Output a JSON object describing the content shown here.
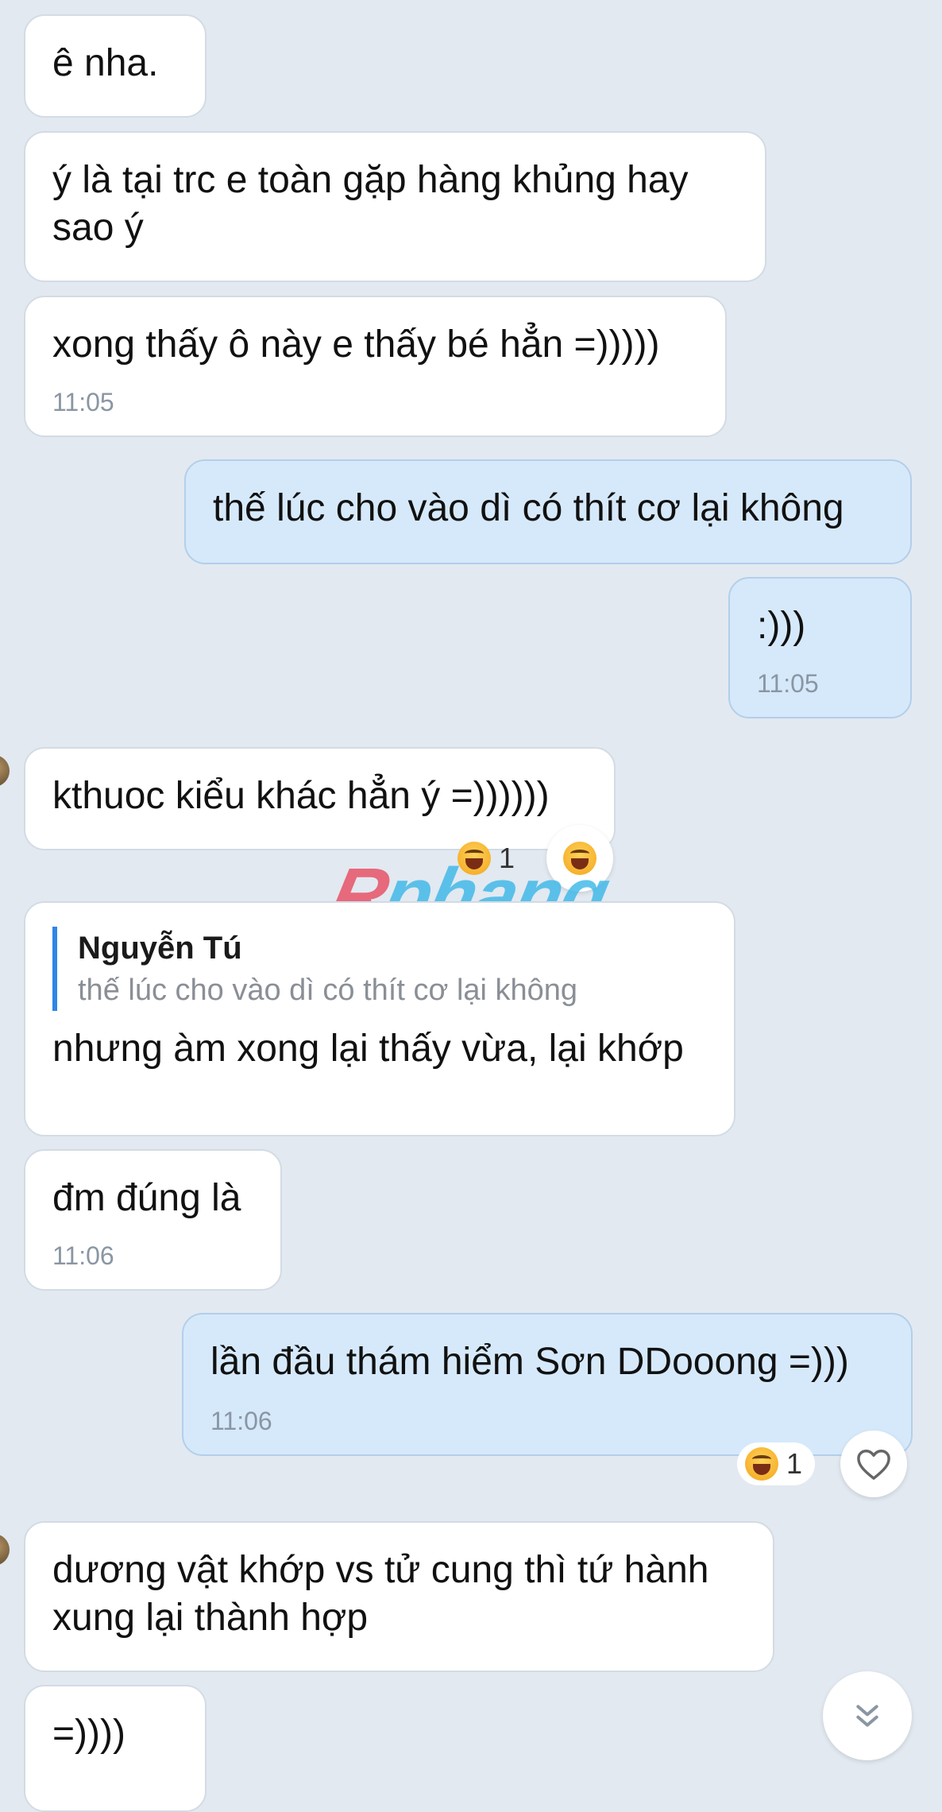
{
  "messages": [
    {
      "id": "m1",
      "dir": "recv",
      "text": "ê nha.",
      "time": ""
    },
    {
      "id": "m2",
      "dir": "recv",
      "text": "ý là tại trc e toàn gặp hàng khủng hay sao ý",
      "time": ""
    },
    {
      "id": "m3",
      "dir": "recv",
      "text": "xong thấy ô này e thấy bé hẳn =)))))",
      "time": "11:05"
    },
    {
      "id": "m4",
      "dir": "sent",
      "text": "thế lúc cho vào dì có thít cơ lại không",
      "time": ""
    },
    {
      "id": "m5",
      "dir": "sent",
      "text": ":)))",
      "time": "11:05"
    },
    {
      "id": "m6",
      "dir": "recv",
      "text": "kthuoc kiểu khác hẳn ý =))))))",
      "time": "",
      "reaction": {
        "emoji": "laughing-face-icon",
        "count": "1"
      }
    },
    {
      "id": "m7",
      "dir": "recv",
      "text": "nhưng àm xong lại thấy vừa, lại khớp",
      "time": "",
      "quote": {
        "author": "Nguyễn Tú",
        "text": "thế lúc cho vào dì có thít cơ lại không"
      }
    },
    {
      "id": "m8",
      "dir": "recv",
      "text": "đm đúng là",
      "time": "11:06"
    },
    {
      "id": "m9",
      "dir": "sent",
      "text": "lần đầu thám hiểm Sơn DDooong =)))",
      "time": "11:06",
      "reaction": {
        "emoji": "laughing-face-icon",
        "count": "1"
      }
    },
    {
      "id": "m10",
      "dir": "recv",
      "text": "dương vật khớp vs tử cung thì tứ hành xung lại thành hợp",
      "time": ""
    },
    {
      "id": "m11",
      "dir": "recv",
      "text": "=))))",
      "time": ""
    }
  ],
  "watermark": {
    "part1": "R",
    "part2": "phang"
  },
  "icons": {
    "reaction": "laughing-face-icon",
    "like": "heart-icon",
    "scroll_down": "double-chevron-down-icon"
  },
  "colors": {
    "background": "#e2e9f1",
    "received_bubble": "#ffffff",
    "sent_bubble": "#d6e9fb",
    "quote_bar": "#2f86e6",
    "timestamp": "#8a96a3"
  }
}
